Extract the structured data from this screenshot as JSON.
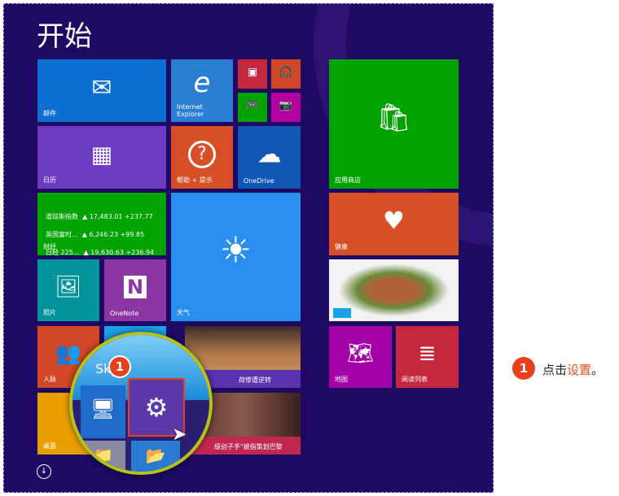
{
  "start_title": "开始",
  "tiles": {
    "mail": "邮件",
    "ie": "Internet Explorer",
    "calendar": "日历",
    "help": "帮助 + 提示",
    "onedrive": "OneDrive",
    "finance": "财经",
    "weather": "天气",
    "photos": "照片",
    "onenote": "OneNote",
    "people": "人脉",
    "desktop": "桌面",
    "store": "应用商店",
    "health": "健康",
    "maps": "地图",
    "reading": "阅读列表",
    "skype": "Sky",
    "sports_caption": "荷惨遭逆转",
    "news_caption": "级刽子手\"被指策划巴黎"
  },
  "finance_lines": [
    {
      "name": "道琼斯指数",
      "value": "▲ 17,483.01 +237.77"
    },
    {
      "name": "英国富时...",
      "value": "▲ 6,246.23 +99.85"
    },
    {
      "name": "日经 225...",
      "value": "▲ 19,630.63 +236.94"
    }
  ],
  "callout": {
    "number": "1",
    "prefix": "点击",
    "highlight": "设置",
    "suffix": "。"
  },
  "colors": {
    "background": "#1e0a63",
    "accent": "#e8401c",
    "magnifier_ring": "#b5c21d"
  }
}
